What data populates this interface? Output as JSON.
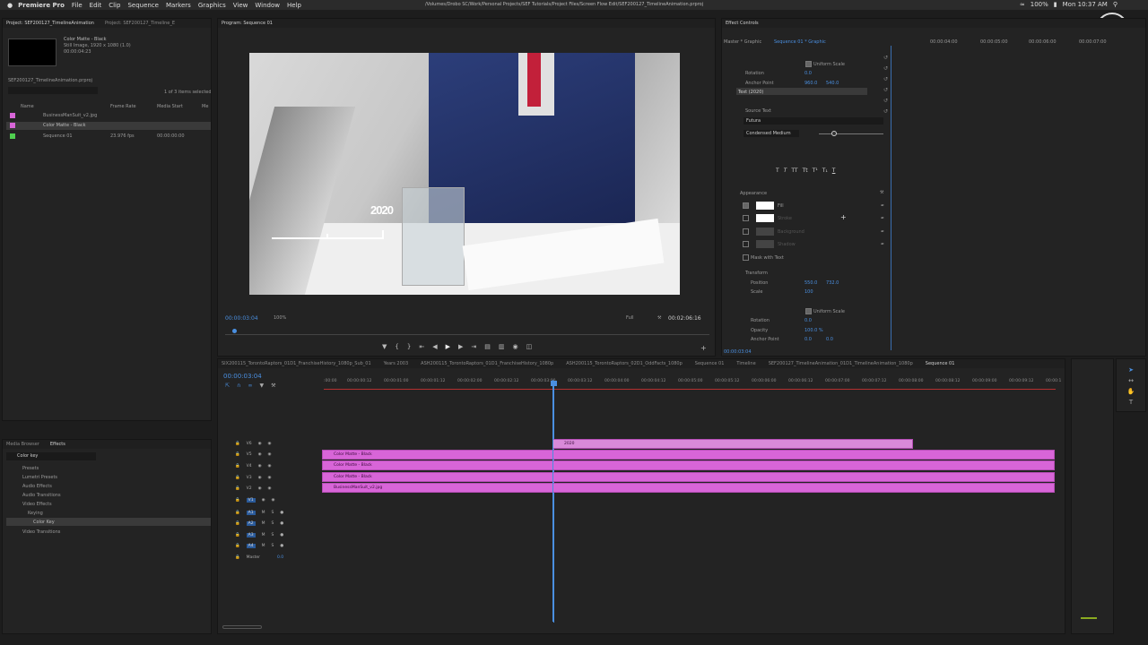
{
  "menubar": {
    "apple": "",
    "app": "Premiere Pro",
    "items": [
      "File",
      "Edit",
      "Clip",
      "Sequence",
      "Markers",
      "Graphics",
      "View",
      "Window",
      "Help"
    ],
    "path": "/Volumes/Drobo SC/Work/Personal Projects/SEF Tutorials/Project Files/Screen Flow Edit/SEF200127_TimelineAnimation.prproj",
    "battery": "100%",
    "time": "Mon 10:37 AM"
  },
  "project": {
    "tabs": [
      "Project: SEF200127_TimelineAnimation",
      "Project: SEF200127_Timeline_E"
    ],
    "clip_name": "Color Matte - Black",
    "clip_type": "Still Image, 1920 x 1080 (1.0)",
    "clip_duration": "00:00:04:23",
    "file": "SEF200127_TimelineAnimation.prproj",
    "items_selected": "1 of 3 items selected",
    "cols": [
      "Name",
      "Frame Rate",
      "Media Start",
      "Me"
    ],
    "items": [
      {
        "name": "BusinessManSuit_v2.jpg",
        "fps": "",
        "start": ""
      },
      {
        "name": "Color Matte - Black",
        "fps": "",
        "start": ""
      },
      {
        "name": "Sequence 01",
        "fps": "23.976 fps",
        "start": "00:00:00:00"
      }
    ]
  },
  "effects": {
    "tabs": [
      "Media Browser",
      "Effects"
    ],
    "search": "Color key",
    "tree": [
      "Presets",
      "Lumetri Presets",
      "Audio Effects",
      "Audio Transitions",
      "Video Effects",
      "Keying",
      "Color Key",
      "Video Transitions"
    ]
  },
  "program": {
    "title": "Program: Sequence 01",
    "overlay_text": "2020",
    "timecode": "00:00:03:04",
    "zoom": "100%",
    "quality": "Full",
    "duration": "00:02:06:16"
  },
  "effect_controls": {
    "title": "Effect Controls",
    "master": "Master * Graphic",
    "seq": "Sequence 01 * Graphic",
    "ruler": [
      "00:00:04:00",
      "00:00:05:00",
      "00:00:06:00",
      "00:00:07:00"
    ],
    "uniform_scale": "Uniform Scale",
    "rotation_label": "Rotation",
    "rotation": "0.0",
    "anchor_label": "Anchor Point",
    "anchor_x": "960.0",
    "anchor_y": "540.0",
    "layer": "Text (2020)",
    "source_text": "Source Text",
    "font": "Futura",
    "style": "Condensed Medium",
    "appearance": "Appearance",
    "fill": "Fill",
    "stroke": "Stroke",
    "background": "Background",
    "shadow": "Shadow",
    "mask": "Mask with Text",
    "transform": "Transform",
    "position_label": "Position",
    "pos_x": "550.0",
    "pos_y": "732.0",
    "scale_label": "Scale",
    "scale": "100",
    "uniform_scale2": "Uniform Scale",
    "rotation2": "0.0",
    "opacity_label": "Opacity",
    "opacity": "100.0 %",
    "anchor2_x": "0.0",
    "anchor2_y": "0.0",
    "timecode": "00:00:03:04"
  },
  "timeline": {
    "tabs": [
      "SIX200115_TorontoRaptors_01D1_FranchiseHistory_1080p_Sub_01",
      "Years 2003",
      "ASH200115_TorontoRaptors_01D1_FranchiseHistory_1080p",
      "ASH200115_TorontoRaptors_02D1_OddFacts_1080p",
      "Sequence 01",
      "Timeline",
      "SEF200127_TimelineAnimation_01D1_TimelineAnimation_1080p",
      "Sequence 01"
    ],
    "timecode": "00:00:03:04",
    "ruler": [
      ":00:00",
      "00:00:00:12",
      "00:00:01:00",
      "00:00:01:12",
      "00:00:02:00",
      "00:00:02:12",
      "00:00:03:00",
      "00:00:03:12",
      "00:00:04:00",
      "00:00:04:12",
      "00:00:05:00",
      "00:00:05:12",
      "00:00:06:00",
      "00:00:06:12",
      "00:00:07:00",
      "00:00:07:12",
      "00:00:08:00",
      "00:00:08:12",
      "00:00:09:00",
      "00:00:09:12",
      "00:00:1"
    ],
    "tracks_v": [
      "V6",
      "V5",
      "V4",
      "V3",
      "V2",
      "V1"
    ],
    "tracks_a": [
      "A1",
      "A2",
      "A3",
      "A4"
    ],
    "master": "Master",
    "master_val": "0.0",
    "clips": [
      {
        "label": "2020"
      },
      {
        "label": "Color Matte - Black"
      },
      {
        "label": "Color Matte - Black"
      },
      {
        "label": "Color Matte - Black"
      },
      {
        "label": "BusinessManSuit_v2.jpg"
      }
    ]
  }
}
